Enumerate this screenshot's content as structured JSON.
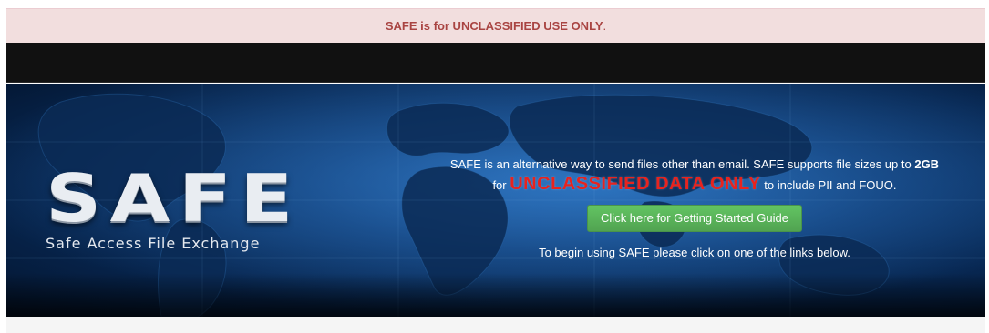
{
  "alert": {
    "text": "SAFE is for UNCLASSIFIED USE ONLY",
    "period": "."
  },
  "logo": {
    "word": "SAFE",
    "subtitle": "Safe Access File Exchange"
  },
  "hero": {
    "intro_part1": "SAFE is an alternative way to send files other than email.  SAFE supports file sizes up to ",
    "intro_size": "2GB",
    "for_word": "for ",
    "red_text": "UNCLASSIFIED DATA ONLY",
    "intro_part2": " to include PII and FOUO.",
    "guide_button": "Click here for Getting Started Guide",
    "begin_text": "To begin using SAFE please click on one of the links below."
  },
  "colors": {
    "alert_bg": "#f2dede",
    "alert_text": "#a94442",
    "navbar_bg": "#111111",
    "accent_red": "#e8231e",
    "button_green": "#5cb85c"
  }
}
